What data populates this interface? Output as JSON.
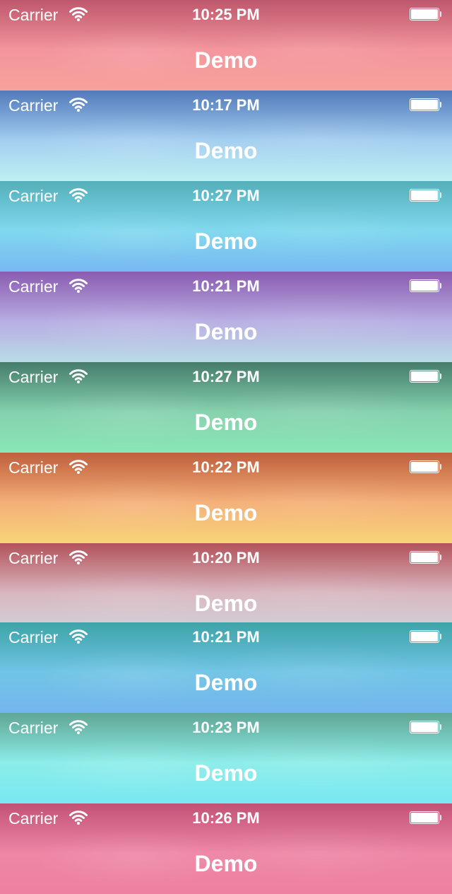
{
  "bars": [
    {
      "carrier": "Carrier",
      "time": "10:25 PM",
      "title": "Demo",
      "colors": [
        "#d4627a",
        "#f3949b",
        "#f7a29d"
      ]
    },
    {
      "carrier": "Carrier",
      "time": "10:17 PM",
      "title": "Demo",
      "colors": [
        "#5b88cf",
        "#a3cef0",
        "#bef0f2"
      ]
    },
    {
      "carrier": "Carrier",
      "time": "10:27 PM",
      "title": "Demo",
      "colors": [
        "#5ec3cf",
        "#7fd8ee",
        "#78b8f2"
      ]
    },
    {
      "carrier": "Carrier",
      "time": "10:21 PM",
      "title": "Demo",
      "colors": [
        "#9a66c4",
        "#b8aee3",
        "#b9dbe6"
      ]
    },
    {
      "carrier": "Carrier",
      "time": "10:27 PM",
      "title": "Demo",
      "colors": [
        "#4e8a78",
        "#84d1ad",
        "#8ae6b7"
      ]
    },
    {
      "carrier": "Carrier",
      "time": "10:22 PM",
      "title": "Demo",
      "colors": [
        "#d56a45",
        "#f4af77",
        "#f7d478"
      ]
    },
    {
      "carrier": "Carrier",
      "time": "10:20 PM",
      "title": "Demo",
      "colors": [
        "#c75c66",
        "#d9b7bf",
        "#cfd3dd"
      ]
    },
    {
      "carrier": "Carrier",
      "time": "10:21 PM",
      "title": "Demo",
      "colors": [
        "#45b6bb",
        "#70c4e6",
        "#74b6ee"
      ]
    },
    {
      "carrier": "Carrier",
      "time": "10:23 PM",
      "title": "Demo",
      "colors": [
        "#6ab9a6",
        "#8cede9",
        "#78e8f2"
      ]
    },
    {
      "carrier": "Carrier",
      "time": "10:26 PM",
      "title": "Demo",
      "colors": [
        "#d85c85",
        "#ee86a6",
        "#ee80a0"
      ]
    }
  ],
  "icons": {
    "wifi": "wifi-icon",
    "battery": "battery-icon"
  }
}
